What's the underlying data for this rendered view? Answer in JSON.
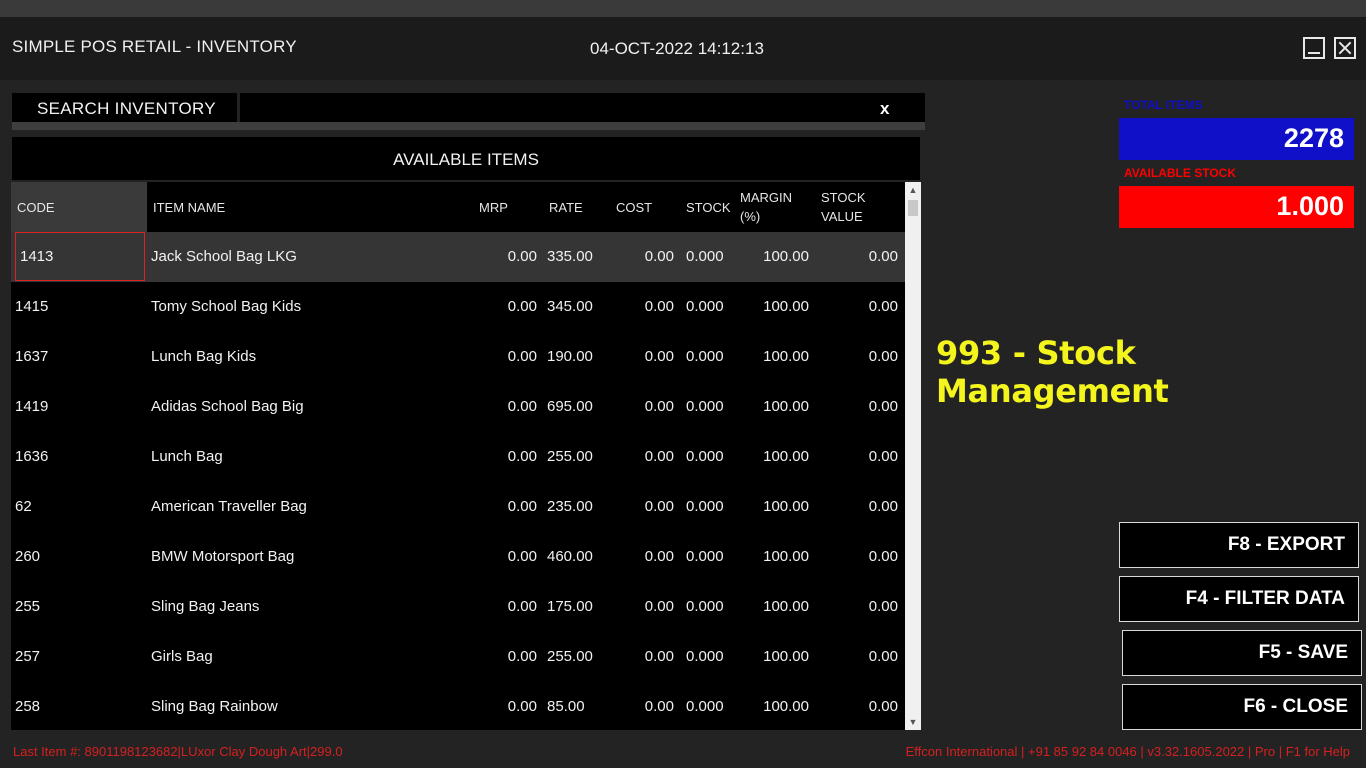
{
  "app": {
    "title": "SIMPLE POS RETAIL - INVENTORY",
    "datetime": "04-OCT-2022 14:12:13"
  },
  "search": {
    "label": "SEARCH INVENTORY",
    "value": "",
    "clear_label": "x"
  },
  "panel": {
    "title": "AVAILABLE ITEMS"
  },
  "grid": {
    "columns": [
      "CODE",
      "ITEM NAME",
      "MRP",
      "RATE",
      "COST",
      "STOCK",
      "MARGIN\n(%)",
      "STOCK\nVALUE"
    ],
    "rows": [
      {
        "code": "1413",
        "name": "Jack School Bag LKG",
        "mrp": "0.00",
        "rate": "335.00",
        "cost": "0.00",
        "stock": "0.000",
        "margin": "100.00",
        "stock_value": "0.00"
      },
      {
        "code": "1415",
        "name": "Tomy School Bag Kids",
        "mrp": "0.00",
        "rate": "345.00",
        "cost": "0.00",
        "stock": "0.000",
        "margin": "100.00",
        "stock_value": "0.00"
      },
      {
        "code": "1637",
        "name": "Lunch Bag Kids",
        "mrp": "0.00",
        "rate": "190.00",
        "cost": "0.00",
        "stock": "0.000",
        "margin": "100.00",
        "stock_value": "0.00"
      },
      {
        "code": "1419",
        "name": "Adidas School Bag Big",
        "mrp": "0.00",
        "rate": "695.00",
        "cost": "0.00",
        "stock": "0.000",
        "margin": "100.00",
        "stock_value": "0.00"
      },
      {
        "code": "1636",
        "name": "Lunch Bag",
        "mrp": "0.00",
        "rate": "255.00",
        "cost": "0.00",
        "stock": "0.000",
        "margin": "100.00",
        "stock_value": "0.00"
      },
      {
        "code": "62",
        "name": "American Traveller Bag",
        "mrp": "0.00",
        "rate": "235.00",
        "cost": "0.00",
        "stock": "0.000",
        "margin": "100.00",
        "stock_value": "0.00"
      },
      {
        "code": "260",
        "name": "BMW Motorsport Bag",
        "mrp": "0.00",
        "rate": "460.00",
        "cost": "0.00",
        "stock": "0.000",
        "margin": "100.00",
        "stock_value": "0.00"
      },
      {
        "code": "255",
        "name": "Sling Bag Jeans",
        "mrp": "0.00",
        "rate": "175.00",
        "cost": "0.00",
        "stock": "0.000",
        "margin": "100.00",
        "stock_value": "0.00"
      },
      {
        "code": "257",
        "name": "Girls Bag",
        "mrp": "0.00",
        "rate": "255.00",
        "cost": "0.00",
        "stock": "0.000",
        "margin": "100.00",
        "stock_value": "0.00"
      },
      {
        "code": "258",
        "name": "Sling Bag Rainbow",
        "mrp": "0.00",
        "rate": "85.00",
        "cost": "0.00",
        "stock": "0.000",
        "margin": "100.00",
        "stock_value": "0.00"
      }
    ]
  },
  "stats": {
    "total_items_label": "TOTAL ITEMS",
    "total_items_value": "2278",
    "total_items_color": "#1010c8",
    "available_stock_label": "AVAILABLE STOCK",
    "available_stock_value": "1.000",
    "available_stock_color": "#ff0000"
  },
  "promo_text": "993 - Stock Management",
  "actions": {
    "export": "F8 - EXPORT",
    "filter": "F4 - FILTER DATA",
    "save": "F5 - SAVE",
    "close": "F6 - CLOSE"
  },
  "footer": {
    "last_item": "Last Item #: 8901198123682|LUxor Clay Dough Art|299.0",
    "info": "Effcon International | +91 85 92 84 0046 | v3.32.1605.2022 | Pro | F1 for Help"
  },
  "colors": {
    "accent_yellow": "#f5f51e",
    "footer_red": "#d42020",
    "selection_border": "#dd2222"
  }
}
